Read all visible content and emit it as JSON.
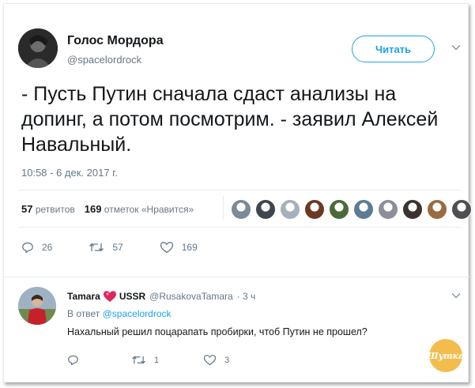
{
  "tweet": {
    "author_name": "Голос Мордора",
    "author_handle": "@spacelordrock",
    "follow_label": "Читать",
    "text": "- Пусть Путин сначала сдаст анализы на допинг, а потом посмотрим. - заявил Алексей Навальный.",
    "timestamp": "10:58 - 6 дек. 2017 г.",
    "retweets_count": "57",
    "retweets_label": "ретвитов",
    "likes_count": "169",
    "likes_label": "отметок «Нравится»",
    "actions": {
      "reply": "26",
      "retweet": "57",
      "like": "169"
    }
  },
  "reply": {
    "name": "Tamara",
    "flag_text": "USSR",
    "handle": "@RusakovaTamara",
    "time": "· 3 ч",
    "reply_to_prefix": "В ответ",
    "reply_to_handle": "@spacelordrock",
    "text": "Нахальный решил поцарапать пробирки, чтоб Путин не прошел?",
    "actions": {
      "reply": "",
      "retweet": "1",
      "like": "3"
    }
  },
  "watermark_text": "Шутка",
  "colors": {
    "accent": "#1da1f2",
    "text_primary": "#14171a",
    "text_secondary": "#657786",
    "heart": "#e0245e",
    "border": "#e6ecf0"
  },
  "liker_avatar_colors": [
    "#7a8a99",
    "#3d4650",
    "#a4b0bc",
    "#6b3a24",
    "#4a6a3a",
    "#5c7c95",
    "#8a8f99",
    "#3a3330",
    "#9a6a40",
    "#4d4f52"
  ]
}
